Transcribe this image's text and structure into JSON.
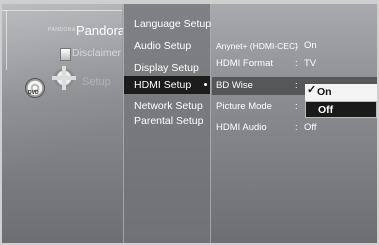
{
  "left_menu": {
    "pandora_logo": "PANDORA",
    "pandora_label": "Pandora",
    "disclaimer_label": "Disclaimer",
    "setup_label": "Setup",
    "dvd_icon_text": "DVD"
  },
  "submenu": {
    "items": [
      {
        "label": "Language Setup"
      },
      {
        "label": "Audio Setup"
      },
      {
        "label": "Display Setup"
      },
      {
        "label": "HDMI Setup"
      },
      {
        "label": "Network Setup"
      },
      {
        "label": "Parental Setup"
      }
    ],
    "active_index": 3
  },
  "settings": {
    "rows": [
      {
        "label": "Anynet+ (HDMI-CEC)",
        "colon": ":",
        "value": "On"
      },
      {
        "label": "HDMI Format",
        "colon": ":",
        "value": "TV"
      },
      {
        "label": "BD Wise",
        "colon": ":",
        "value": ""
      },
      {
        "label": "Picture Mode",
        "colon": ":",
        "value": ""
      },
      {
        "label": "HDMI Audio",
        "colon": ":",
        "value": "Off"
      }
    ]
  },
  "dropdown": {
    "check_mark": "✓",
    "options": [
      {
        "label": "On",
        "selected": true
      },
      {
        "label": "Off",
        "selected": false
      }
    ]
  },
  "icons": [
    "pandora-logo",
    "disclaimer-icon",
    "dvd-disc-icon",
    "gear-icon",
    "check-icon"
  ]
}
